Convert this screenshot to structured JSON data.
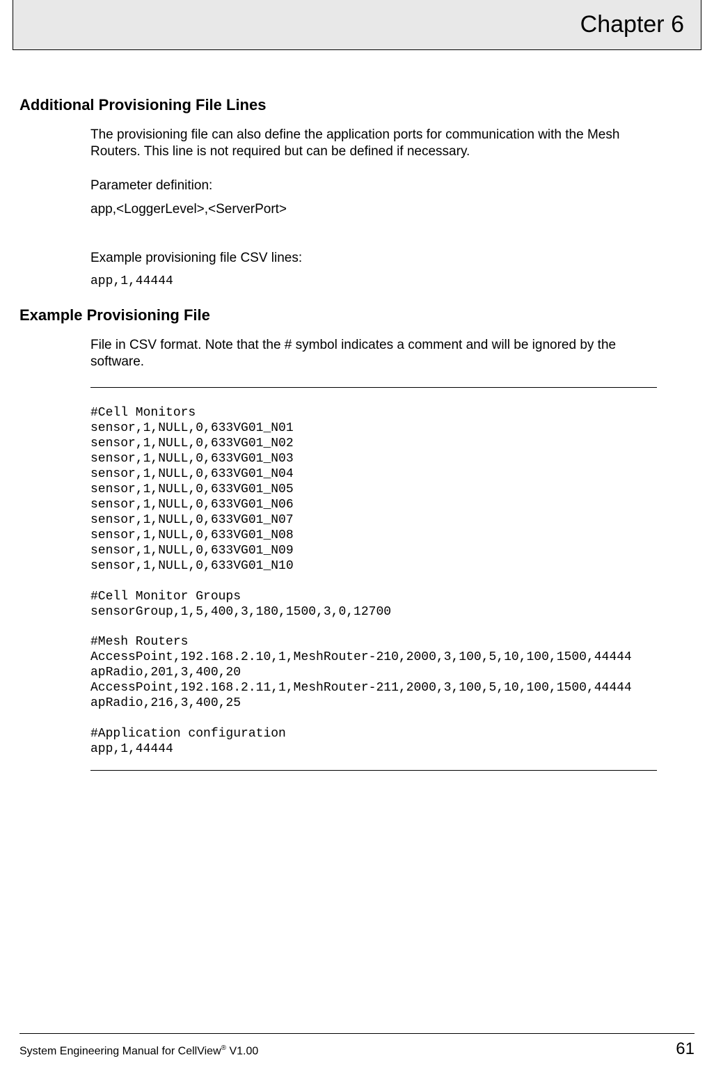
{
  "header": {
    "chapter": "Chapter 6"
  },
  "section1": {
    "title": "Additional Provisioning File Lines",
    "p1": "The provisioning file can also define the application ports for communication with the Mesh Routers. This line is not required but can be defined if necessary.",
    "p2": "Parameter definition:",
    "p3": "app,<LoggerLevel>,<ServerPort>",
    "p4": "Example provisioning file CSV lines:",
    "p5": "app,1,44444"
  },
  "section2": {
    "title": "Example Provisioning File",
    "p1": "File in CSV format.  Note that the # symbol indicates a comment and will be ignored by the software.",
    "csv": "#Cell Monitors\nsensor,1,NULL,0,633VG01_N01\nsensor,1,NULL,0,633VG01_N02\nsensor,1,NULL,0,633VG01_N03\nsensor,1,NULL,0,633VG01_N04\nsensor,1,NULL,0,633VG01_N05\nsensor,1,NULL,0,633VG01_N06\nsensor,1,NULL,0,633VG01_N07\nsensor,1,NULL,0,633VG01_N08\nsensor,1,NULL,0,633VG01_N09\nsensor,1,NULL,0,633VG01_N10\n\n#Cell Monitor Groups\nsensorGroup,1,5,400,3,180,1500,3,0,12700\n\n#Mesh Routers\nAccessPoint,192.168.2.10,1,MeshRouter-210,2000,3,100,5,10,100,1500,44444\napRadio,201,3,400,20\nAccessPoint,192.168.2.11,1,MeshRouter-211,2000,3,100,5,10,100,1500,44444\napRadio,216,3,400,25\n\n#Application configuration\napp,1,44444"
  },
  "footer": {
    "left_pre": "System Engineering Manual for CellView",
    "left_sup": "®",
    "left_post": " V1.00",
    "page": "61"
  }
}
